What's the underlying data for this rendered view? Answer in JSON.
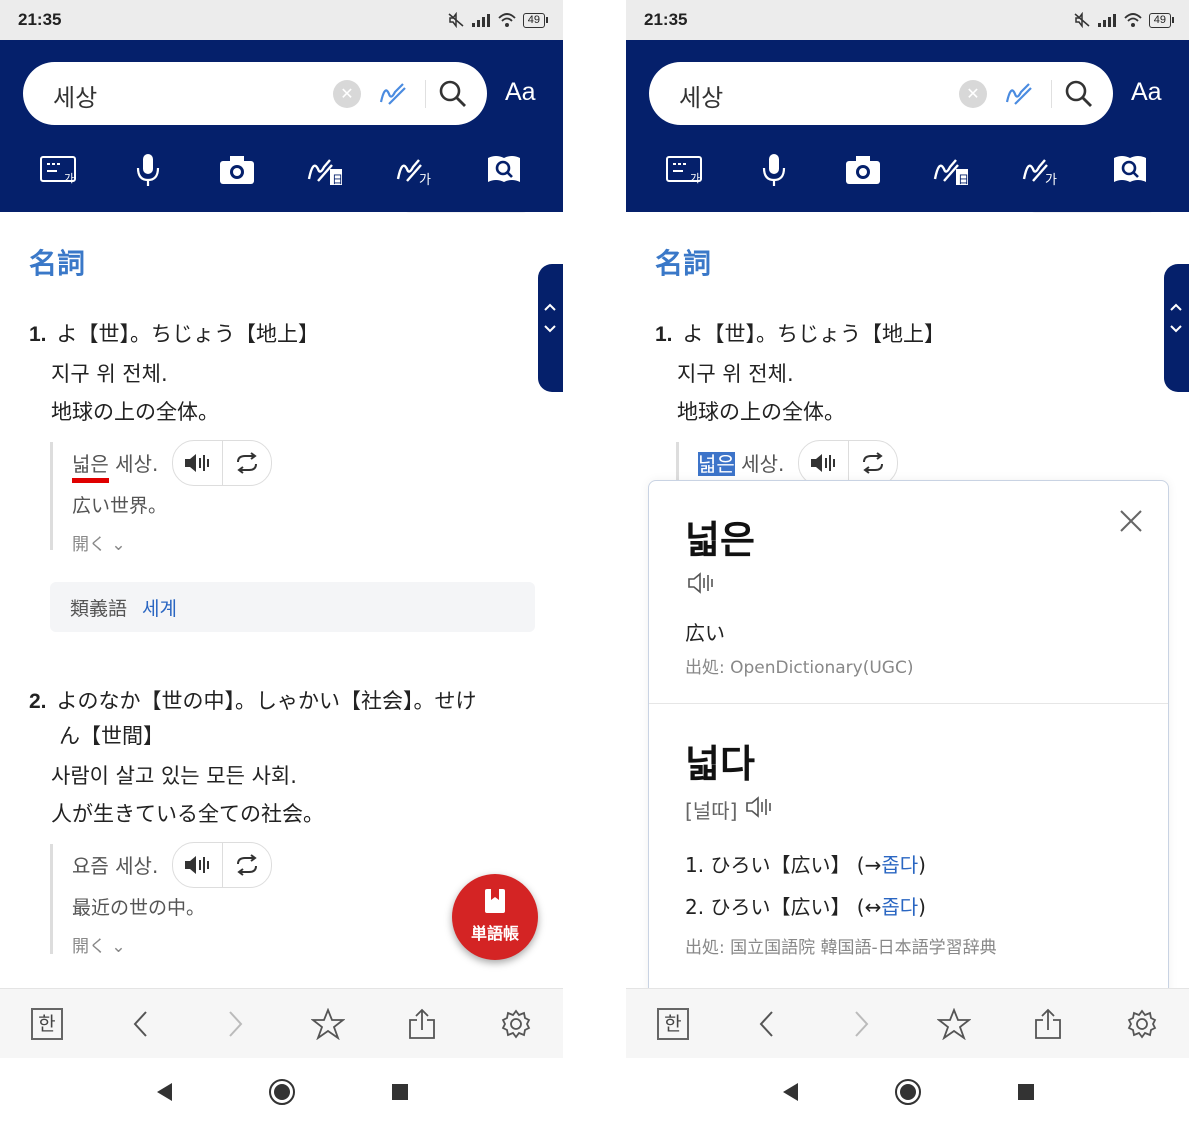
{
  "status": {
    "time": "21:35",
    "battery": "49"
  },
  "search": {
    "query": "세상",
    "font_button": "Aa"
  },
  "tools": [
    "keyboard-icon",
    "microphone-icon",
    "camera-icon",
    "handwriting-icon",
    "handwriting-korean-icon",
    "dictionary-search-icon"
  ],
  "entry": {
    "pos": "名詞",
    "sense1": {
      "num": "1.",
      "ja": "よ【世】。ちじょう【地上】",
      "ko": "지구 위 전체.",
      "gloss": "地球の上の全体。",
      "example": {
        "ko_word": "넓은",
        "ko_rest": " 세상.",
        "ja": "広い世界。",
        "more": "開く"
      }
    },
    "synonym": {
      "label": "類義語",
      "word": "세계"
    },
    "sense2": {
      "num": "2.",
      "ja_line1": "よのなか【世の中】。しゃかい【社会】。せけ",
      "ja_line2": "ん【世間】",
      "ko": "사람이 살고 있는 모든 사회.",
      "gloss": "人が生きている全ての社会。",
      "example": {
        "ko": "요즘 세상.",
        "ja": "最近の世の中。",
        "more": "開く"
      }
    },
    "wordbook_label": "単語帳"
  },
  "popup": {
    "word1": "넓은",
    "meaning1": "広い",
    "source1": "出処: OpenDictionary(UGC)",
    "word2": "넓다",
    "pron2": "[널따]",
    "defs": [
      {
        "text": "1. ひろい【広い】 (→",
        "link": "좁다",
        "tail": ")"
      },
      {
        "text": "2. ひろい【広い】 (↔",
        "link": "좁다",
        "tail": ")"
      }
    ],
    "source2": "出処: 国立国語院 韓国語-日本語学習辞典"
  },
  "bottom": {
    "lang_button": "한"
  }
}
